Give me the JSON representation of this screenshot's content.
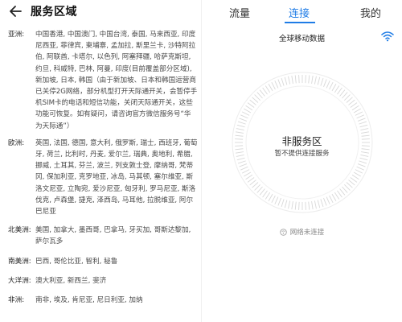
{
  "left_panel": {
    "title": "服务区域",
    "regions": [
      {
        "name": "亚洲:",
        "countries": "中国香港, 中国澳门, 中国台湾, 泰国, 马来西亚, 印度尼西亚, 菲律宾, 柬埔寨, 孟加拉, 斯里兰卡, 沙特阿拉伯, 阿联酋, 卡塔尔, 以色列, 阿塞拜疆, 哈萨克斯坦, 约旦, 科威特, 巴林, 阿曼, 印度(目前覆盖部分区域), 新加坡, 日本, 韩国（由于新加坡、日本和韩国运营商已关停2G网络，部分机型打开天际通开关，会暂停手机SIM卡的电话和短信功能，关闭天际通开关，这些功能可恢复。如有疑问，请咨询官方微信服务号“华为天际通”）"
      },
      {
        "name": "欧洲:",
        "countries": "英国, 法国, 德国, 意大利, 俄罗斯, 瑞士, 西班牙, 葡萄牙, 荷兰, 比利时, 丹麦, 爱尔兰, 瑞典, 奥地利, 希腊, 挪威, 土耳其, 芬兰, 波兰, 列支敦士登, 摩纳哥, 梵蒂冈, 保加利亚, 克罗地亚, 冰岛, 马其顿, 塞尔维亚, 斯洛文尼亚, 立陶宛, 爱沙尼亚, 匈牙利, 罗马尼亚, 斯洛伐克, 卢森堡, 捷克, 泽西岛, 马耳他, 拉脱维亚, 阿尔巴尼亚"
      },
      {
        "name": "北美洲:",
        "countries": "美国, 加拿大, 墨西哥, 巴拿马, 牙买加, 哥斯达黎加, 萨尔瓦多"
      },
      {
        "name": "南美洲:",
        "countries": "巴西, 哥伦比亚, 智利, 秘鲁"
      },
      {
        "name": "大洋洲:",
        "countries": "澳大利亚, 新西兰, 斐济"
      },
      {
        "name": "非洲:",
        "countries": "南非, 埃及, 肯尼亚, 尼日利亚, 加纳"
      }
    ]
  },
  "right_panel": {
    "tabs": [
      {
        "label": "流量",
        "active": false
      },
      {
        "label": "连接",
        "active": true
      },
      {
        "label": "我的",
        "active": false
      }
    ],
    "data_label": "全球移动数据",
    "status_main": "非服务区",
    "status_sub": "暂不提供连接服务",
    "network_status": "网络未连接",
    "icons": {
      "back": "back-arrow-icon",
      "wifi": "wifi-icon",
      "network": "network-status-icon"
    },
    "colors": {
      "accent": "#1f7ce6",
      "dial_ring": "#e5e5e5",
      "dial_tick": "#d8d8d8"
    }
  }
}
